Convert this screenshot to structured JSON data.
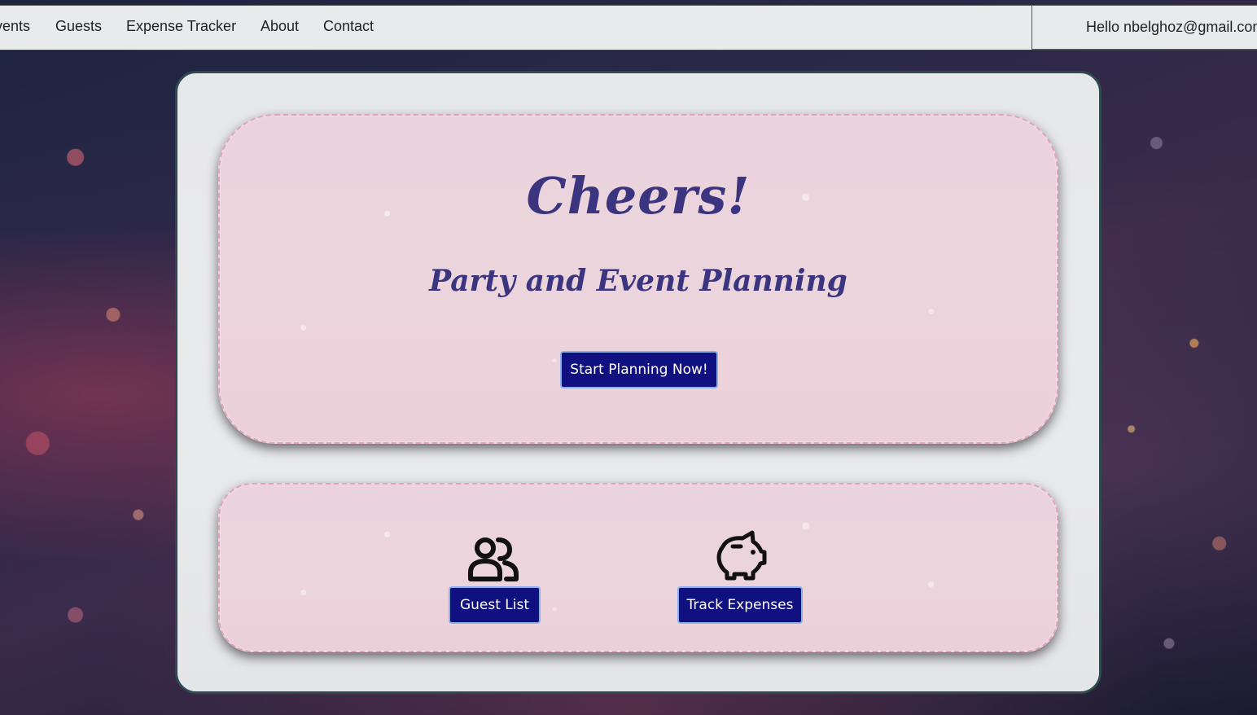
{
  "navbar": {
    "links": [
      {
        "label": "vents"
      },
      {
        "label": "Guests"
      },
      {
        "label": "Expense Tracker"
      },
      {
        "label": "About"
      },
      {
        "label": "Contact"
      }
    ],
    "user_greeting": "Hello nbelghoz@gmail.com"
  },
  "hero": {
    "title": "Cheers!",
    "subtitle": "Party and Event Planning",
    "cta_label": "Start Planning Now!"
  },
  "features": {
    "guest_list": {
      "icon": "people-icon",
      "label": "Guest List"
    },
    "track_expenses": {
      "icon": "piggy-bank-icon",
      "label": "Track Expenses"
    }
  },
  "colors": {
    "navbar_bg": "#e9eaeb",
    "card_border": "#2f4a4f",
    "panel_bg": "#ead3dc",
    "title_color": "#3b3580",
    "button_bg": "#101080",
    "button_border": "#8ab0e8"
  }
}
